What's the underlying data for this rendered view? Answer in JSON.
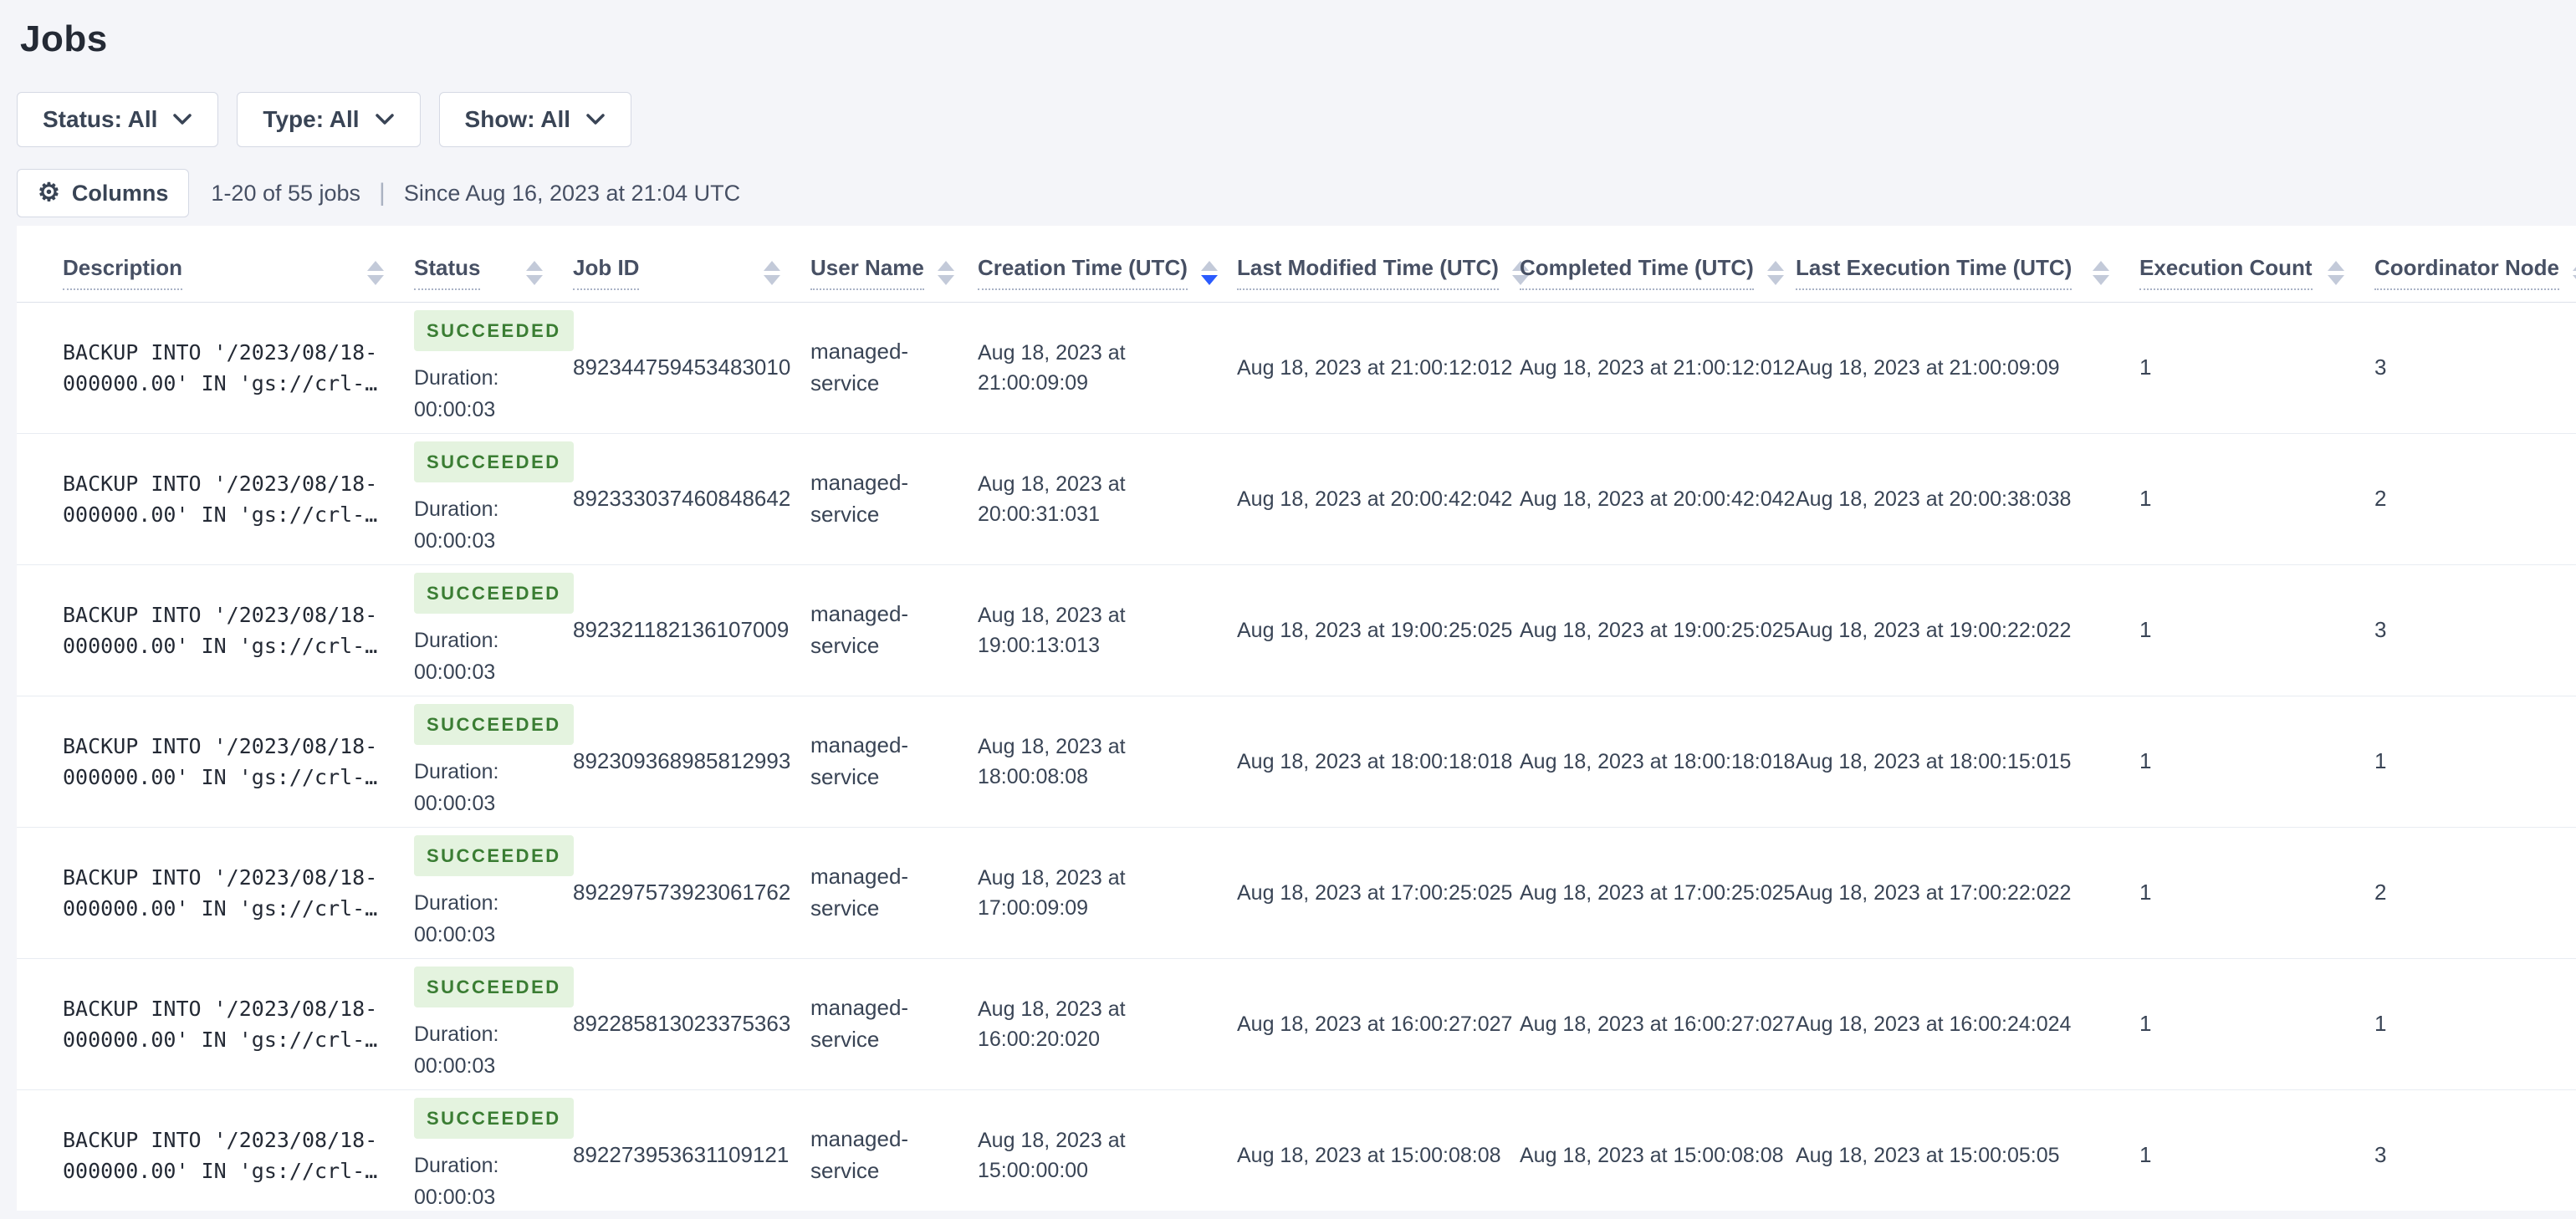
{
  "page": {
    "title": "Jobs"
  },
  "filters": [
    {
      "label": "Status: All"
    },
    {
      "label": "Type: All"
    },
    {
      "label": "Show: All"
    }
  ],
  "toolbar": {
    "columns_label": "Columns",
    "columns_icon": "⚙",
    "count_text": "1-20 of 55 jobs",
    "separator": "|",
    "since_text": "Since Aug 16, 2023 at 21:04 UTC"
  },
  "table": {
    "columns": [
      {
        "label": "Description",
        "sort": "none"
      },
      {
        "label": "Status",
        "sort": "none"
      },
      {
        "label": "Job ID",
        "sort": "none"
      },
      {
        "label": "User Name",
        "sort": "none"
      },
      {
        "label": "Creation Time (UTC)",
        "sort": "desc"
      },
      {
        "label": "Last Modified Time (UTC)",
        "sort": "none"
      },
      {
        "label": "Completed Time (UTC)",
        "sort": "none"
      },
      {
        "label": "Last Execution Time (UTC)",
        "sort": "none"
      },
      {
        "label": "Execution Count",
        "sort": "none"
      },
      {
        "label": "Coordinator Node",
        "sort": "none"
      }
    ],
    "rows": [
      {
        "description_line1": "BACKUP INTO '/2023/08/18-",
        "description_line2": "000000.00' IN 'gs://crl-…",
        "status": "SUCCEEDED",
        "duration": "Duration: 00:00:03",
        "job_id": "892344759453483010",
        "user_name": "managed-service",
        "creation_time": "Aug 18, 2023 at 21:00:09:09",
        "last_modified_time": "Aug 18, 2023 at 21:00:12:012",
        "completed_time": "Aug 18, 2023 at 21:00:12:012",
        "last_execution_time": "Aug 18, 2023 at 21:00:09:09",
        "execution_count": "1",
        "coordinator_node": "3"
      },
      {
        "description_line1": "BACKUP INTO '/2023/08/18-",
        "description_line2": "000000.00' IN 'gs://crl-…",
        "status": "SUCCEEDED",
        "duration": "Duration: 00:00:03",
        "job_id": "892333037460848642",
        "user_name": "managed-service",
        "creation_time": "Aug 18, 2023 at 20:00:31:031",
        "last_modified_time": "Aug 18, 2023 at 20:00:42:042",
        "completed_time": "Aug 18, 2023 at 20:00:42:042",
        "last_execution_time": "Aug 18, 2023 at 20:00:38:038",
        "execution_count": "1",
        "coordinator_node": "2"
      },
      {
        "description_line1": "BACKUP INTO '/2023/08/18-",
        "description_line2": "000000.00' IN 'gs://crl-…",
        "status": "SUCCEEDED",
        "duration": "Duration: 00:00:03",
        "job_id": "892321182136107009",
        "user_name": "managed-service",
        "creation_time": "Aug 18, 2023 at 19:00:13:013",
        "last_modified_time": "Aug 18, 2023 at 19:00:25:025",
        "completed_time": "Aug 18, 2023 at 19:00:25:025",
        "last_execution_time": "Aug 18, 2023 at 19:00:22:022",
        "execution_count": "1",
        "coordinator_node": "3"
      },
      {
        "description_line1": "BACKUP INTO '/2023/08/18-",
        "description_line2": "000000.00' IN 'gs://crl-…",
        "status": "SUCCEEDED",
        "duration": "Duration: 00:00:03",
        "job_id": "892309368985812993",
        "user_name": "managed-service",
        "creation_time": "Aug 18, 2023 at 18:00:08:08",
        "last_modified_time": "Aug 18, 2023 at 18:00:18:018",
        "completed_time": "Aug 18, 2023 at 18:00:18:018",
        "last_execution_time": "Aug 18, 2023 at 18:00:15:015",
        "execution_count": "1",
        "coordinator_node": "1"
      },
      {
        "description_line1": "BACKUP INTO '/2023/08/18-",
        "description_line2": "000000.00' IN 'gs://crl-…",
        "status": "SUCCEEDED",
        "duration": "Duration: 00:00:03",
        "job_id": "892297573923061762",
        "user_name": "managed-service",
        "creation_time": "Aug 18, 2023 at 17:00:09:09",
        "last_modified_time": "Aug 18, 2023 at 17:00:25:025",
        "completed_time": "Aug 18, 2023 at 17:00:25:025",
        "last_execution_time": "Aug 18, 2023 at 17:00:22:022",
        "execution_count": "1",
        "coordinator_node": "2"
      },
      {
        "description_line1": "BACKUP INTO '/2023/08/18-",
        "description_line2": "000000.00' IN 'gs://crl-…",
        "status": "SUCCEEDED",
        "duration": "Duration: 00:00:03",
        "job_id": "892285813023375363",
        "user_name": "managed-service",
        "creation_time": "Aug 18, 2023 at 16:00:20:020",
        "last_modified_time": "Aug 18, 2023 at 16:00:27:027",
        "completed_time": "Aug 18, 2023 at 16:00:27:027",
        "last_execution_time": "Aug 18, 2023 at 16:00:24:024",
        "execution_count": "1",
        "coordinator_node": "1"
      },
      {
        "description_line1": "BACKUP INTO '/2023/08/18-",
        "description_line2": "000000.00' IN 'gs://crl-…",
        "status": "SUCCEEDED",
        "duration": "Duration: 00:00:03",
        "job_id": "892273953631109121",
        "user_name": "managed-service",
        "creation_time": "Aug 18, 2023 at 15:00:00:00",
        "last_modified_time": "Aug 18, 2023 at 15:00:08:08",
        "completed_time": "Aug 18, 2023 at 15:00:08:08",
        "last_execution_time": "Aug 18, 2023 at 15:00:05:05",
        "execution_count": "1",
        "coordinator_node": "3"
      }
    ]
  },
  "icons": {
    "columns_button": "gear-icon",
    "filter_buttons": "chevron-down-icon",
    "column_headers": "sort-arrows-icon"
  },
  "colors": {
    "page_background": "#f4f5f9",
    "card_background": "#ffffff",
    "badge_background": "#e4f3df",
    "badge_text": "#3a7d33",
    "active_sort_arrow": "#2b5bfe",
    "inactive_sort_arrow": "#c3cad9",
    "heading_text": "#242a35",
    "body_text": "#394455"
  }
}
